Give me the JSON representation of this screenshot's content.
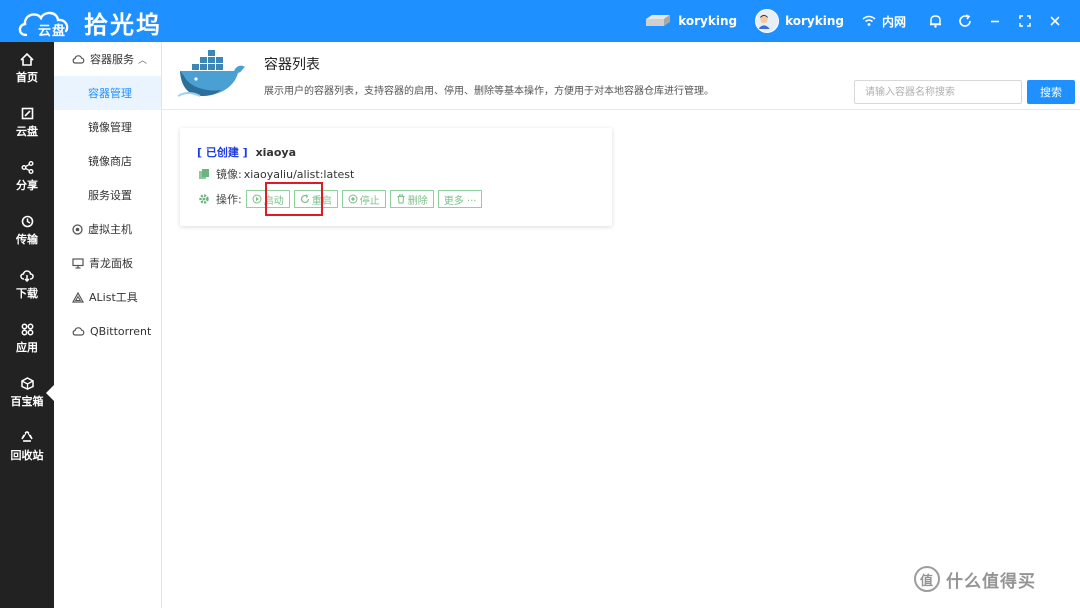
{
  "app": {
    "logo_cloud_text": "云盘",
    "brand": "拾光坞"
  },
  "topbar": {
    "device_name": "koryking",
    "user_name": "koryking",
    "network": "内网"
  },
  "left_nav": [
    {
      "label": "首页",
      "icon": "home-icon"
    },
    {
      "label": "云盘",
      "icon": "cloud-drive-icon"
    },
    {
      "label": "分享",
      "icon": "share-icon"
    },
    {
      "label": "传输",
      "icon": "transfer-icon"
    },
    {
      "label": "下载",
      "icon": "download-icon"
    },
    {
      "label": "应用",
      "icon": "apps-icon"
    },
    {
      "label": "百宝箱",
      "icon": "toolbox-icon",
      "active": true
    },
    {
      "label": "回收站",
      "icon": "recycle-icon"
    }
  ],
  "sub_nav": {
    "group_container": "容器服务",
    "items": [
      {
        "label": "容器管理",
        "active": true
      },
      {
        "label": "镜像管理"
      },
      {
        "label": "镜像商店"
      },
      {
        "label": "服务设置"
      }
    ],
    "vm": "虚拟主机",
    "qinglong": "青龙面板",
    "alist": "AList工具",
    "qbittorrent": "QBittorrent"
  },
  "page": {
    "title": "容器列表",
    "description": "展示用户的容器列表，支持容器的启用、停用、删除等基本操作，方便用于对本地容器仓库进行管理。",
    "search_placeholder": "请输入容器名称搜索",
    "search_button": "搜索"
  },
  "container": {
    "status": "[ 已创建 ]",
    "name": "xiaoya",
    "image_label": "镜像:",
    "image_value": "xiaoyaliu/alist:latest",
    "ops_label": "操作:",
    "ops": {
      "start": "启动",
      "restart": "重启",
      "stop": "停止",
      "delete": "删除",
      "more": "更多 ···"
    }
  },
  "watermark": {
    "symbol": "值",
    "text": "什么值得买"
  },
  "colors": {
    "primary": "#1e90ff",
    "nav_bg": "#222222",
    "status_blue": "#1e3ce0",
    "op_green": "#7bbf89",
    "highlight_red": "#e01b24"
  }
}
